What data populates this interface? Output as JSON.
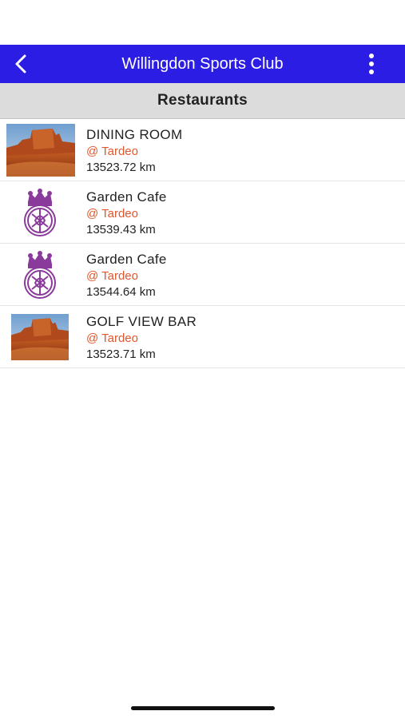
{
  "app_bar": {
    "title": "Willingdon Sports Club",
    "back_icon": "chevron-left-icon",
    "more_icon": "more-vertical-icon",
    "background_color": "#2c1de4"
  },
  "section": {
    "title": "Restaurants"
  },
  "restaurants": [
    {
      "name": "DINING ROOM",
      "location": "@ Tardeo",
      "distance": "13523.72 km",
      "image": "desert-mesa-photo"
    },
    {
      "name": "Garden Cafe",
      "location": "@ Tardeo",
      "distance": "13539.43 km",
      "image": "club-crest-logo"
    },
    {
      "name": "Garden Cafe",
      "location": "@ Tardeo",
      "distance": "13544.64 km",
      "image": "club-crest-logo"
    },
    {
      "name": "GOLF VIEW BAR",
      "location": "@ Tardeo",
      "distance": "13523.71 km",
      "image": "desert-mesa-photo"
    }
  ],
  "colors": {
    "location_text": "#e0572d",
    "crest": "#8a3a9a"
  }
}
